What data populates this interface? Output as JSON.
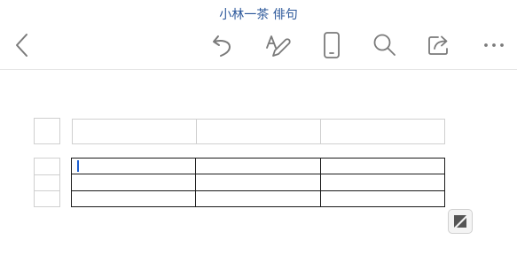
{
  "header": {
    "document_title": "小林一茶 俳句"
  },
  "toolbar": {
    "icons": [
      "back-icon",
      "undo-icon",
      "draw-icon",
      "mobile-view-icon",
      "search-icon",
      "share-icon",
      "more-icon"
    ]
  },
  "table": {
    "rows": [
      [
        "",
        "",
        ""
      ],
      [
        "",
        "",
        ""
      ],
      [
        "",
        "",
        ""
      ]
    ]
  },
  "colors": {
    "accent": "#2b579a",
    "icon": "#7a7a7a",
    "cursor": "#1d5fd1"
  }
}
